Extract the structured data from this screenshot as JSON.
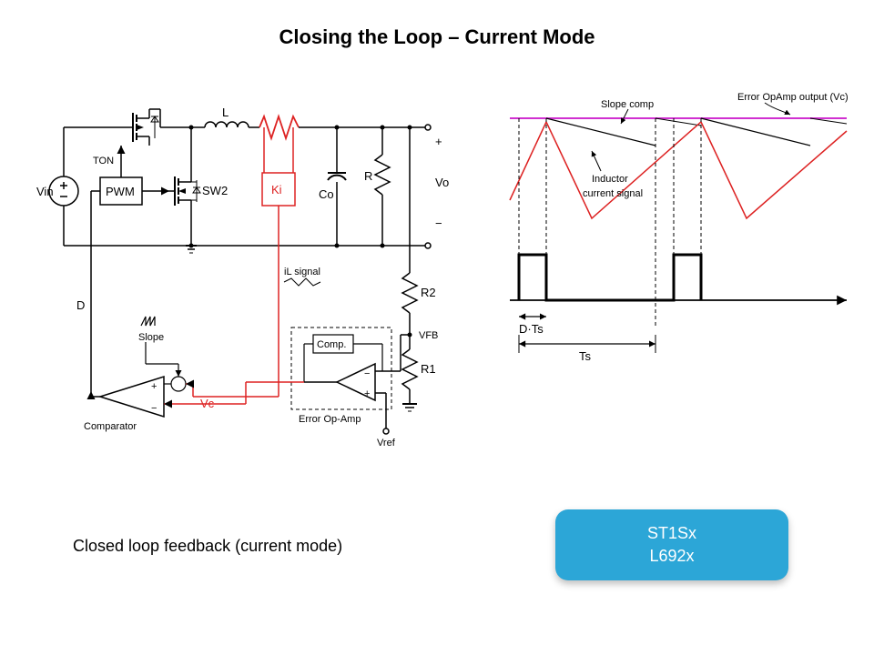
{
  "title": "Closing the Loop – Current Mode",
  "caption": "Closed loop feedback (current mode)",
  "callout": {
    "line1": "ST1Sx",
    "line2": "L692x"
  },
  "schematic": {
    "Vin": "Vin",
    "Ton": "TON",
    "PWM": "PWM",
    "SW2": "SW2",
    "L": "L",
    "Ki": "Ki",
    "Co": "Co",
    "R": "R",
    "Vo_plus": "+",
    "Vo": "Vo",
    "Vo_minus": "−",
    "iL_signal": "iL signal",
    "D": "D",
    "Slope": "Slope",
    "Comparator": "Comparator",
    "Vc": "Vc",
    "Comp": "Comp.",
    "ErrorOpAmp": "Error Op-Amp",
    "Vref": "Vref",
    "R2": "R2",
    "Vfb": "VFB",
    "R1": "R1"
  },
  "timing": {
    "slope_comp": "Slope comp",
    "err_out": "Error OpAmp output (Vc)",
    "inductor": "Inductor",
    "current_signal": "current signal",
    "DTs": "D·Ts",
    "Ts": "Ts"
  }
}
